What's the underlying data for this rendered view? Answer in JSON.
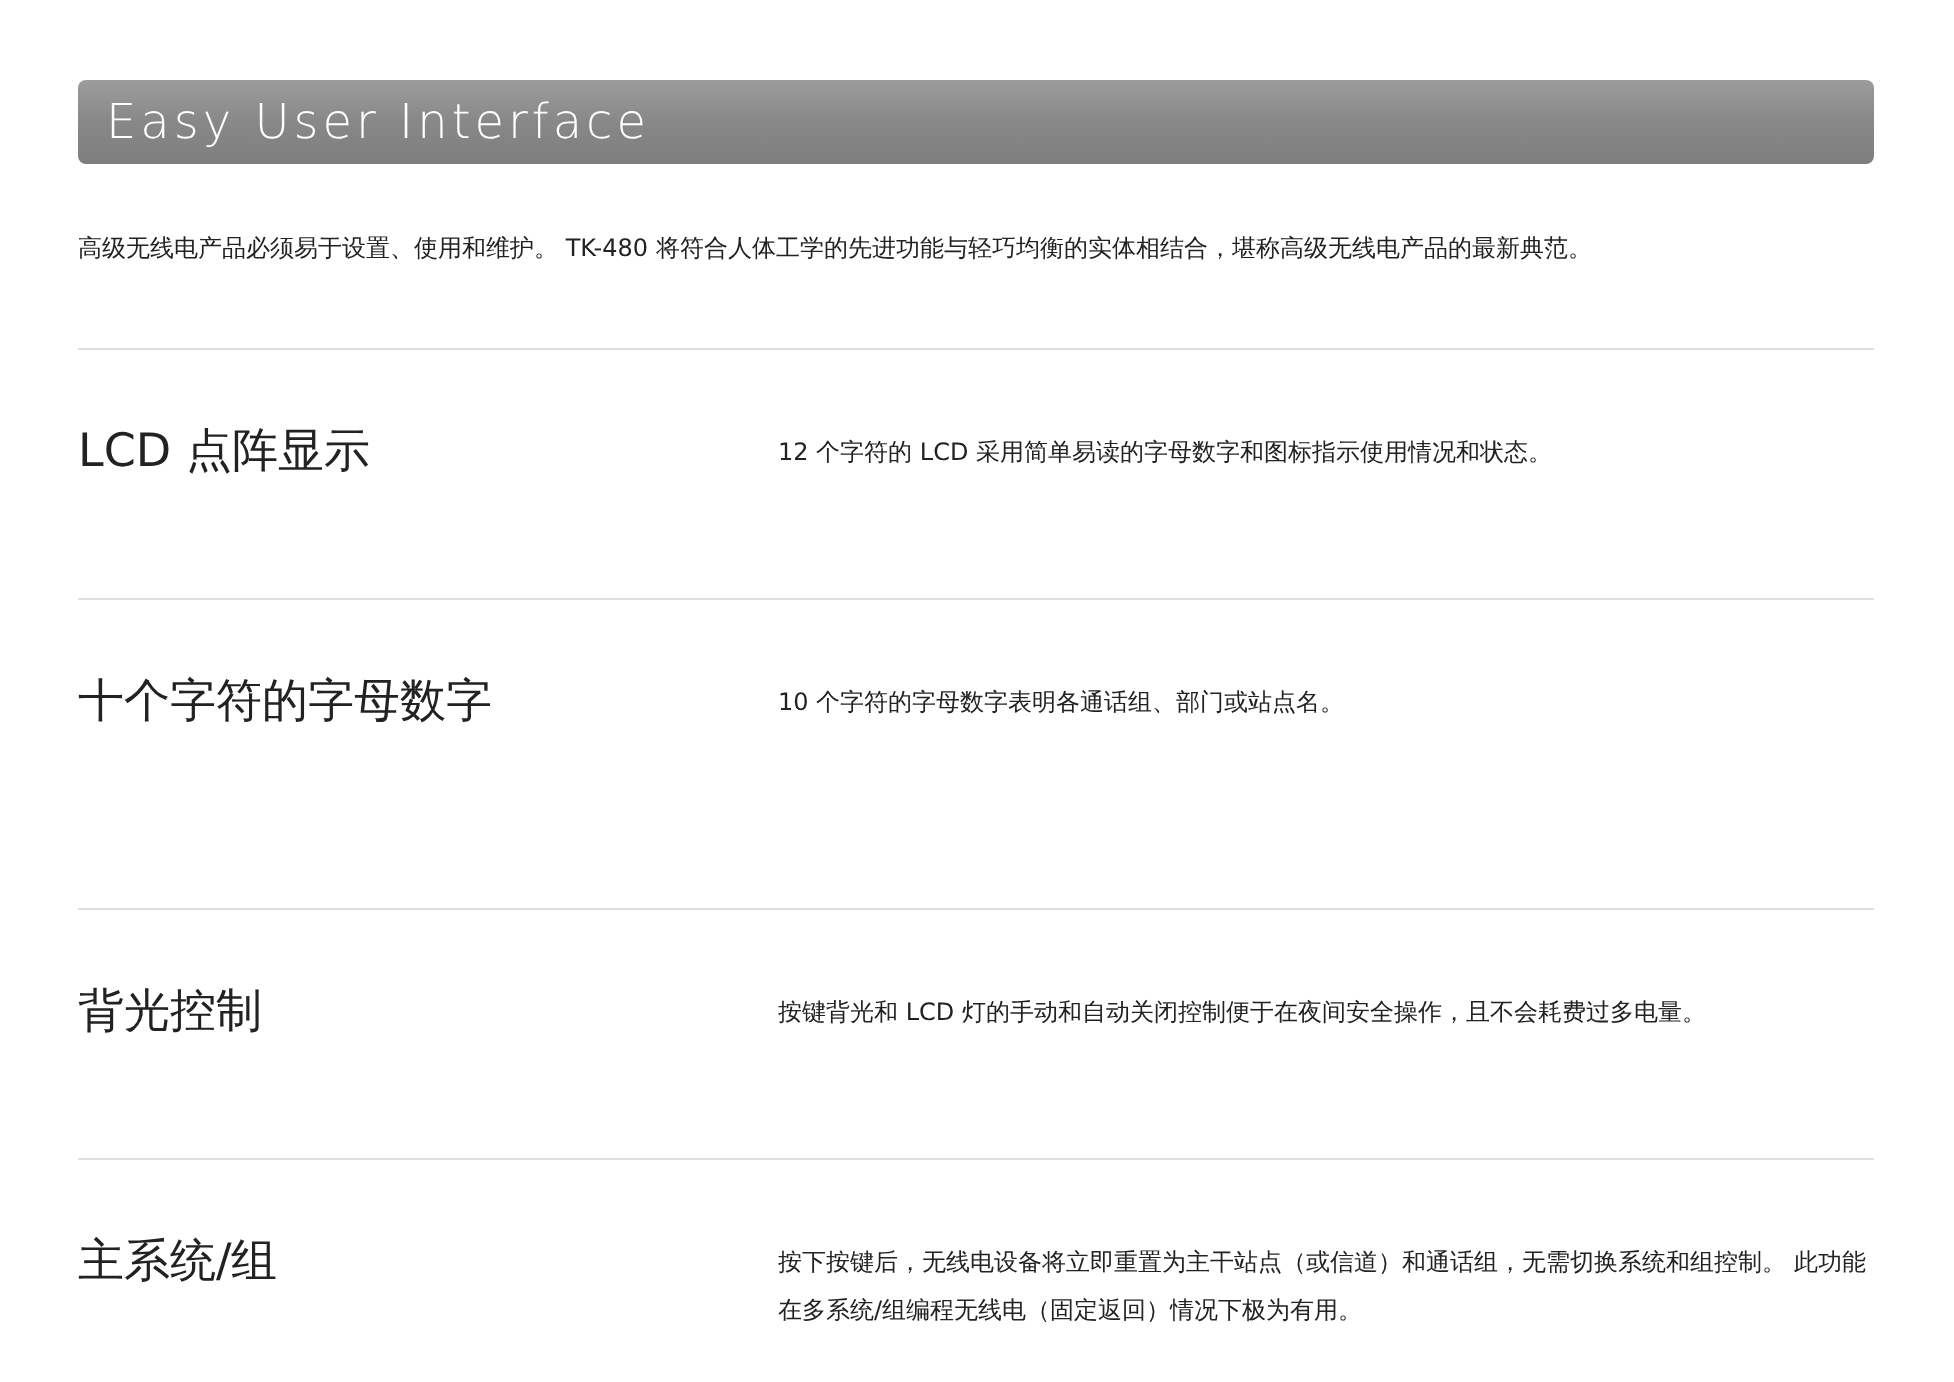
{
  "banner": {
    "title": "Easy User Interface"
  },
  "intro": "高级无线电产品必须易于设置、使用和维护。 TK-480 将符合人体工学的先进功能与轻巧均衡的实体相结合，堪称高级无线电产品的最新典范。",
  "features": [
    {
      "title": "LCD 点阵显示",
      "description": "12 个字符的 LCD 采用简单易读的字母数字和图标指示使用情况和状态。"
    },
    {
      "title": "十个字符的字母数字",
      "description": "10 个字符的字母数字表明各通话组、部门或站点名。"
    },
    {
      "title": "背光控制",
      "description": "按键背光和 LCD 灯的手动和自动关闭控制便于在夜间安全操作，且不会耗费过多电量。"
    },
    {
      "title": "主系统/组",
      "description": "按下按键后，无线电设备将立即重置为主干站点（或信道）和通话组，无需切换系统和组控制。 此功能在多系统/组编程无线电（固定返回）情况下极为有用。"
    }
  ]
}
